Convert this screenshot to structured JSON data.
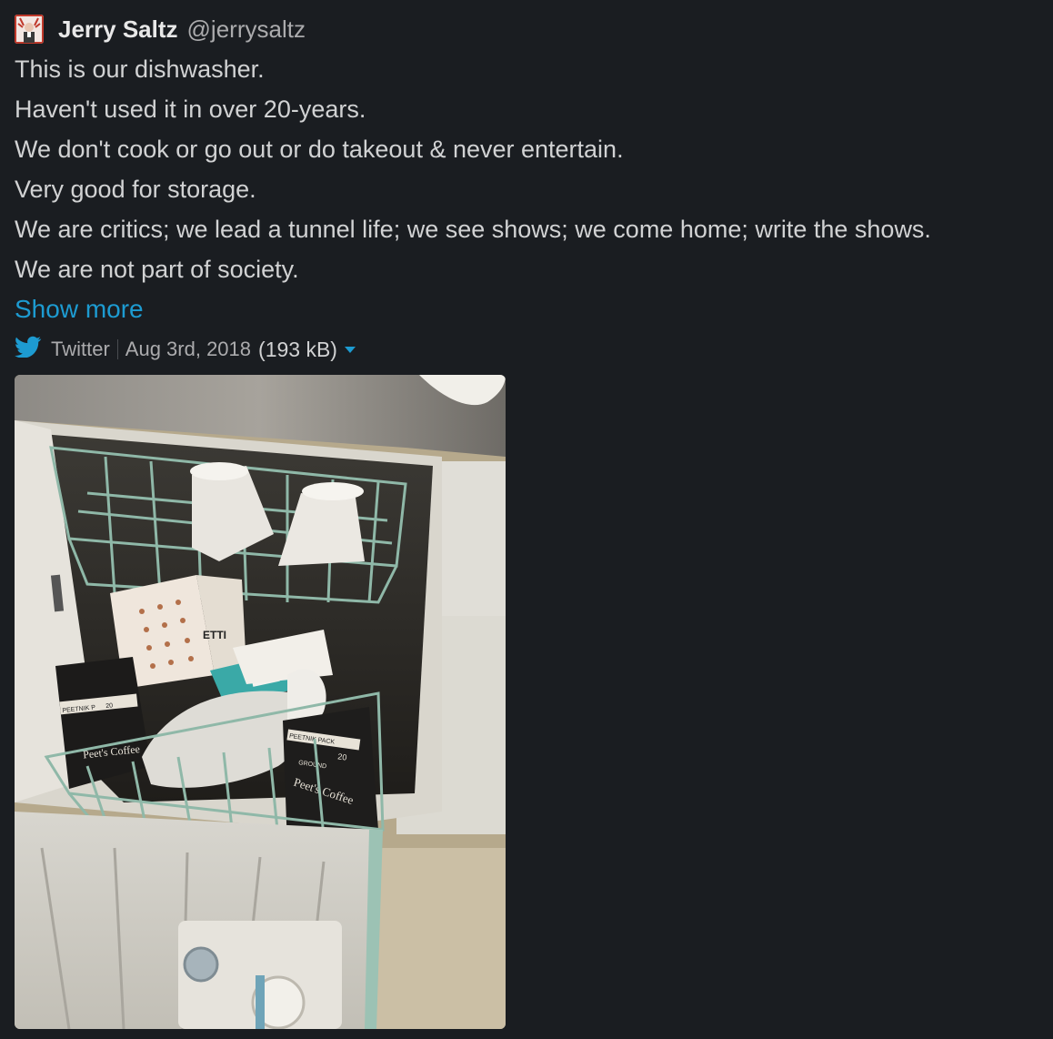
{
  "message": {
    "author_name": "Jerry Saltz",
    "author_handle": "@jerrysaltz",
    "lines": [
      "This is our dishwasher.",
      "Haven't used it in over 20-years.",
      "We don't cook or go out or do takeout & never entertain.",
      "Very good for storage.",
      "We are critics; we lead a tunnel life; we see shows; we come home; write the shows.",
      "We are not part of society."
    ],
    "show_more": "Show more"
  },
  "attachment": {
    "source": "Twitter",
    "date": "Aug 3rd, 2018",
    "size": "(193 kB)",
    "icon": "twitter-bird-icon",
    "image_text": {
      "box_brand": "ETTI",
      "bag_brand_left": "Peet's Coffee",
      "bag_brand_right": "Peet's Coffee",
      "bag_pack_right": "PEETNIK PACK",
      "bag_pack_left": "PEETNIK P",
      "bag_count_right": "20",
      "bag_count_left": "20",
      "bag_ground": "GROUND"
    }
  },
  "colors": {
    "background": "#1a1d21",
    "link": "#1d9bd1",
    "text": "#d1d2d3"
  }
}
